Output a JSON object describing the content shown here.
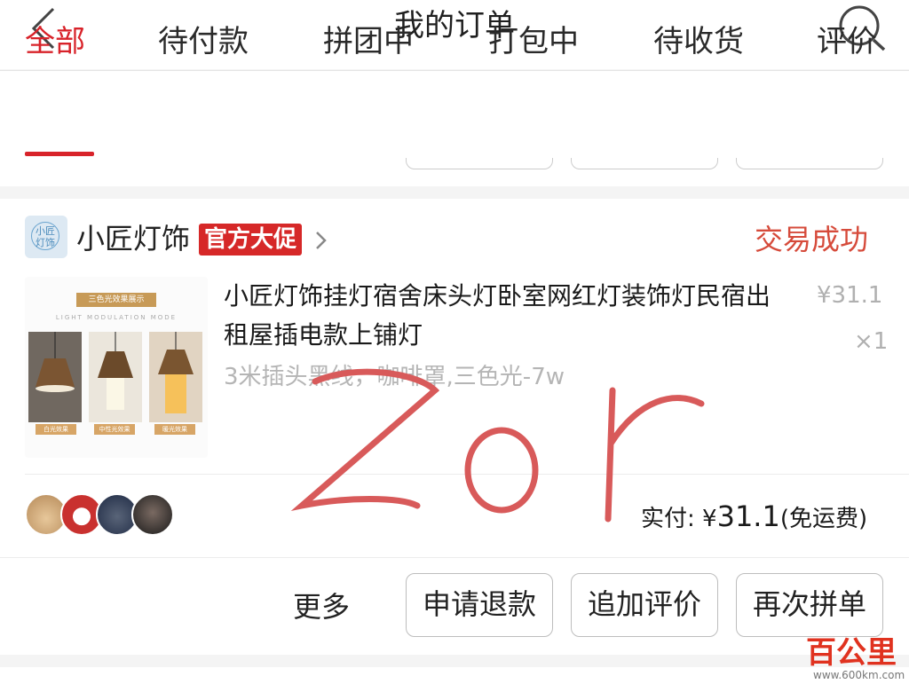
{
  "header": {
    "title": "我的订单",
    "back_icon": "back-chevron-icon",
    "search_icon": "search-icon"
  },
  "tabs": [
    {
      "label": "全部",
      "active": true
    },
    {
      "label": "待付款"
    },
    {
      "label": "拼团中"
    },
    {
      "label": "打包中"
    },
    {
      "label": "待收货"
    },
    {
      "label": "评价"
    }
  ],
  "order": {
    "shop": {
      "logo_text": "小匠灯饰",
      "name": "小匠灯饰",
      "promo_badge": "官方大促"
    },
    "status": "交易成功",
    "product": {
      "title": "小匠灯饰挂灯宿舍床头灯卧室网红灯装饰灯民宿出租屋插电款上铺灯",
      "spec": "3米插头黑线，咖啡罩,三色光-7w",
      "unit_price": "¥31.1",
      "quantity": "×1",
      "thumb": {
        "tag": "三色光效果展示",
        "subtitle": "LIGHT MODULATION MODE",
        "captions": [
          "白光效果",
          "中性光效果",
          "暖光效果"
        ]
      }
    },
    "payment": {
      "label": "实付:",
      "currency": "¥",
      "amount": "31.1",
      "note": "(免运费)"
    },
    "actions": {
      "more": "更多",
      "refund": "申请退款",
      "review": "追加评价",
      "rebuy": "再次拼单"
    }
  },
  "watermark": {
    "brand": "百公里",
    "url": "www.600km.com"
  },
  "colors": {
    "accent": "#d8232a",
    "status": "#d64b3b",
    "promo": "#d62828"
  }
}
